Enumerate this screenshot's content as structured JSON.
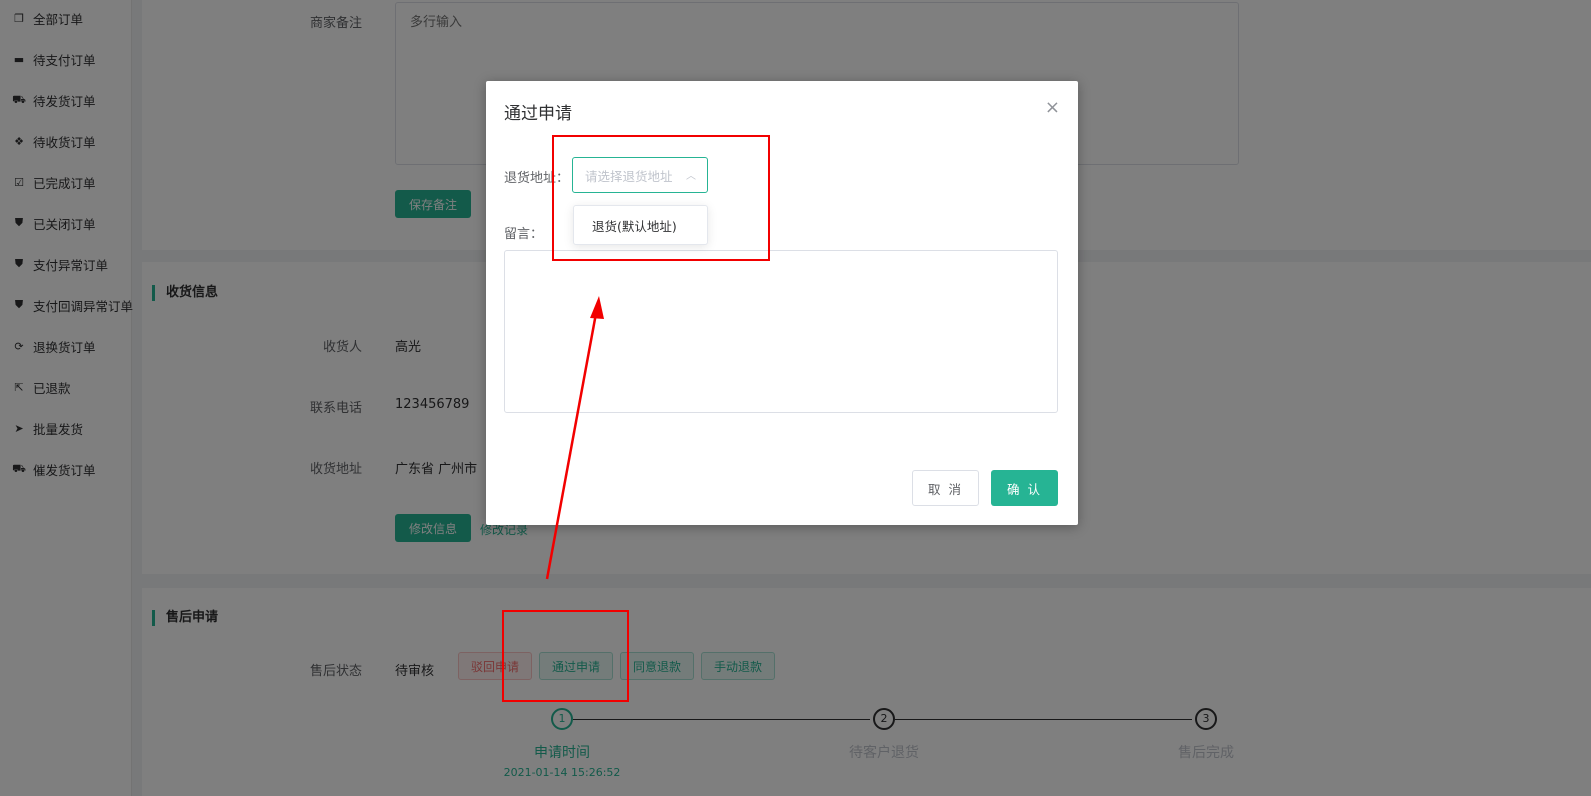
{
  "sidebar": {
    "items": [
      {
        "label": "全部订单",
        "icon": "copy-icon",
        "glyph": "❐"
      },
      {
        "label": "待支付订单",
        "icon": "credit-card-icon",
        "glyph": "▬"
      },
      {
        "label": "待发货订单",
        "icon": "truck-icon",
        "glyph": "⛟"
      },
      {
        "label": "待收货订单",
        "icon": "dropbox-icon",
        "glyph": "❖"
      },
      {
        "label": "已完成订单",
        "icon": "check-square-icon",
        "glyph": "☑"
      },
      {
        "label": "已关闭订单",
        "icon": "shield-icon",
        "glyph": "⛊"
      },
      {
        "label": "支付异常订单",
        "icon": "shield-icon",
        "glyph": "⛊"
      },
      {
        "label": "支付回调异常订单",
        "icon": "shield-icon",
        "glyph": "⛊"
      },
      {
        "label": "退换货订单",
        "icon": "refresh-icon",
        "glyph": "⟳"
      },
      {
        "label": "已退款",
        "icon": "share-icon",
        "glyph": "⇱"
      },
      {
        "label": "批量发货",
        "icon": "paper-plane-icon",
        "glyph": "➤"
      },
      {
        "label": "催发货订单",
        "icon": "truck-icon",
        "glyph": "⛟"
      }
    ]
  },
  "remark": {
    "label": "商家备注",
    "placeholder": "多行输入",
    "save_button": "保存备注"
  },
  "receiver": {
    "section_title": "收货信息",
    "name_label": "收货人",
    "name_value": "高光",
    "phone_label": "联系电话",
    "phone_value": "123456789",
    "address_label": "收货地址",
    "address_value": "广东省 广州市 ",
    "modify_button": "修改信息",
    "modify_log_link": "修改记录"
  },
  "aftersale": {
    "section_title": "售后申请",
    "status_label": "售后状态",
    "status_value": "待审核",
    "reject_button": "驳回申请",
    "approve_button": "通过申请",
    "agree_refund_button": "同意退款",
    "manual_refund_button": "手动退款",
    "steps": [
      {
        "num": "1",
        "title": "申请时间",
        "desc": "2021-01-14 15:26:52"
      },
      {
        "num": "2",
        "title": "待客户退货",
        "desc": ""
      },
      {
        "num": "3",
        "title": "售后完成",
        "desc": ""
      }
    ]
  },
  "dialog": {
    "title": "通过申请",
    "close_glyph": "×",
    "address_label": "退货地址：",
    "address_placeholder": "请选择退货地址",
    "chevron_glyph": "︿",
    "dropdown_options": [
      "退货(默认地址)"
    ],
    "message_label": "留言：",
    "cancel_button": "取 消",
    "confirm_button": "确 认"
  },
  "colors": {
    "accent": "#26b494",
    "annotation": "#f20000",
    "overlay": "rgba(0,0,0,0.5)"
  }
}
